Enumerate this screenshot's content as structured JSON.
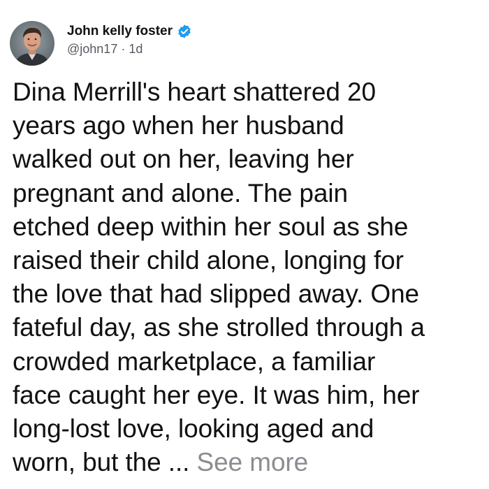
{
  "author": {
    "name": "John kelly foster",
    "handle": "@john17",
    "separator": " · ",
    "time": "1d",
    "avatar_icon": "avatar-photo-icon",
    "verified_icon": "verified-badge-icon",
    "verified_color": "#1d9bf0"
  },
  "post": {
    "lines": [
      "Dina Merrill's heart shattered 20",
      "years ago when her husband",
      "walked out on her, leaving her",
      "pregnant and alone. The pain",
      "etched deep within her soul as she",
      "raised their child alone, longing for",
      "the love that had slipped away. One",
      "fateful day, as she strolled through a",
      "crowded marketplace, a familiar",
      "face caught her eye. It was him, her",
      "long-lost love, looking aged and",
      "worn, but the ..."
    ],
    "see_more_label": "See more",
    "see_more_color": "#8a8d91",
    "text_color": "#111111"
  }
}
